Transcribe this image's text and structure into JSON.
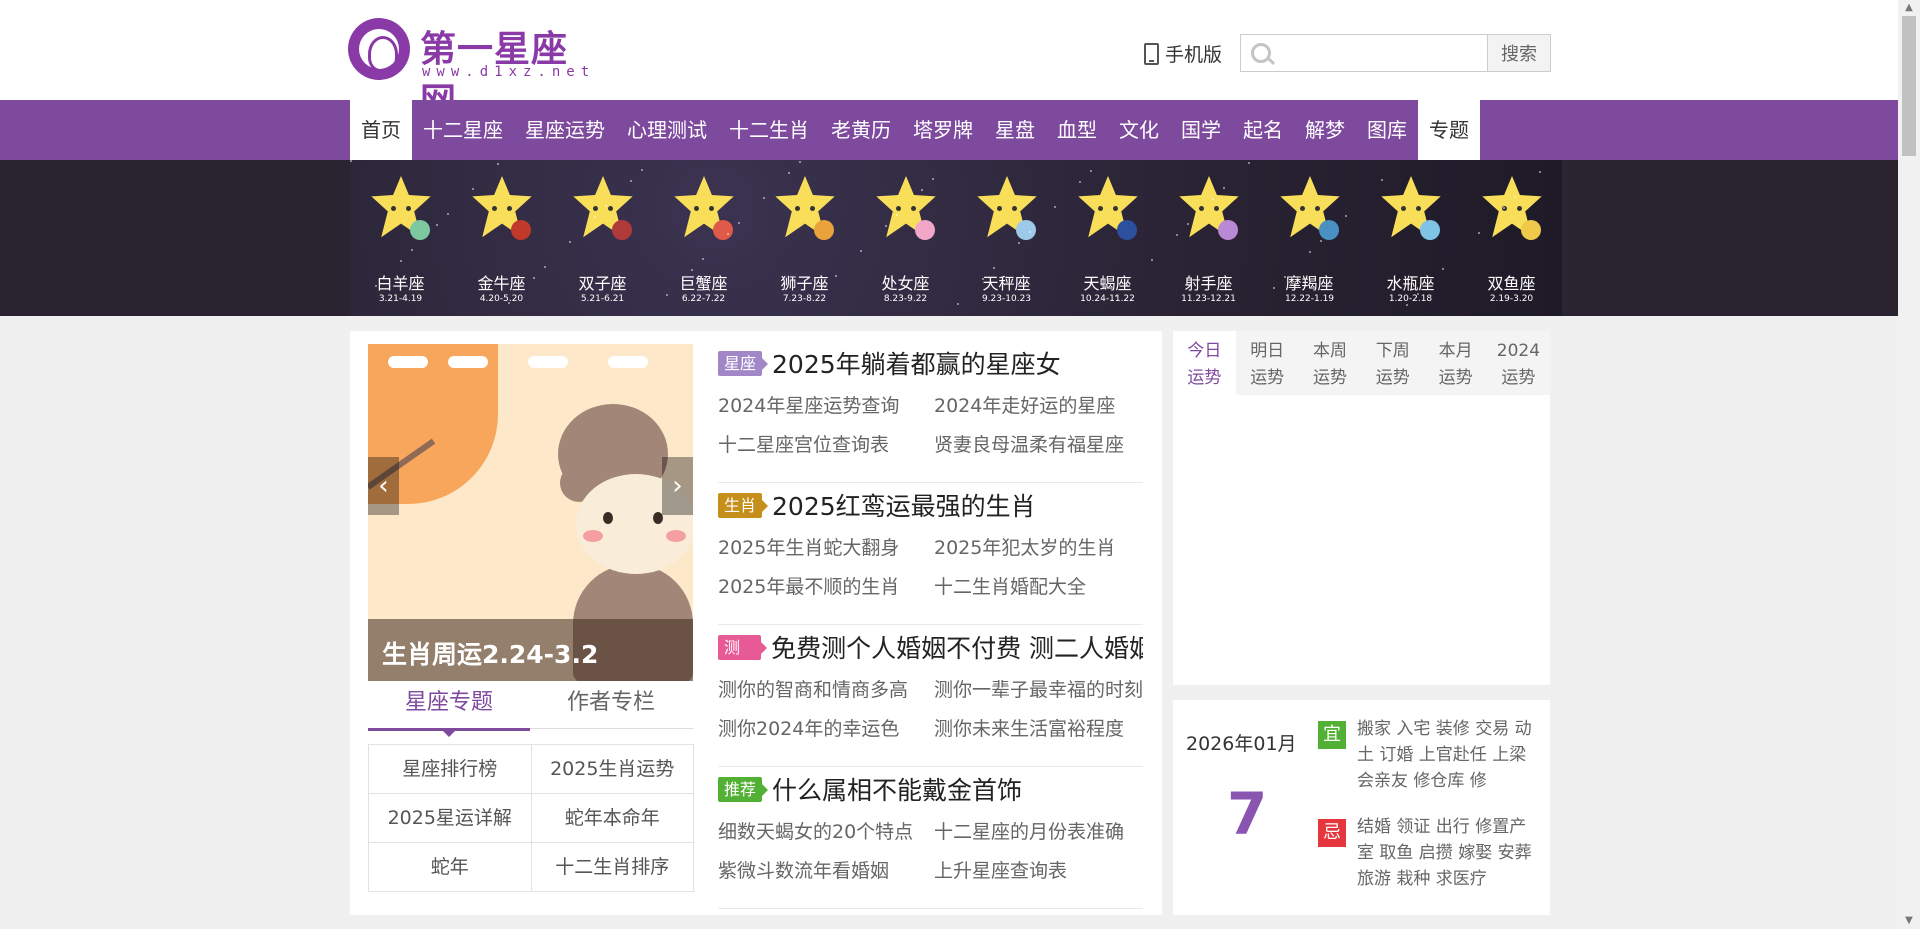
{
  "header": {
    "logo_title": "第一星座网",
    "logo_url": "www.d1xz.net",
    "mobile_label": "手机版",
    "search_placeholder": "",
    "search_button": "搜索"
  },
  "nav": {
    "items": [
      "首页",
      "十二星座",
      "星座运势",
      "心理测试",
      "十二生肖",
      "老黄历",
      "塔罗牌",
      "星盘",
      "血型",
      "文化",
      "国学",
      "起名",
      "解梦",
      "图库",
      "专题"
    ],
    "active_index": [
      0,
      14
    ]
  },
  "zodiacs": [
    {
      "name": "白羊座",
      "date": "3.21-4.19",
      "accent": "#7ec8a0"
    },
    {
      "name": "金牛座",
      "date": "4.20-5.20",
      "accent": "#c0392b"
    },
    {
      "name": "双子座",
      "date": "5.21-6.21",
      "accent": "#b03a3a"
    },
    {
      "name": "巨蟹座",
      "date": "6.22-7.22",
      "accent": "#e05a4a"
    },
    {
      "name": "狮子座",
      "date": "7.23-8.22",
      "accent": "#e8a33c"
    },
    {
      "name": "处女座",
      "date": "8.23-9.22",
      "accent": "#f2a7c9"
    },
    {
      "name": "天秤座",
      "date": "9.23-10.23",
      "accent": "#9ec9e8"
    },
    {
      "name": "天蝎座",
      "date": "10.24-11.22",
      "accent": "#2c4f9e"
    },
    {
      "name": "射手座",
      "date": "11.23-12.21",
      "accent": "#b989d6"
    },
    {
      "name": "摩羯座",
      "date": "12.22-1.19",
      "accent": "#4a90c2"
    },
    {
      "name": "水瓶座",
      "date": "1.20-2.18",
      "accent": "#7fc3e6"
    },
    {
      "name": "双鱼座",
      "date": "2.19-3.20",
      "accent": "#f0c94a"
    }
  ],
  "slider": {
    "caption": "生肖周运2.24-3.2",
    "prev_icon": "chevron-left-icon",
    "next_icon": "chevron-right-icon"
  },
  "tabs": [
    "星座专题",
    "作者专栏"
  ],
  "topics": [
    "星座排行榜",
    "2025生肖运势",
    "2025星运详解",
    "蛇年本命年",
    "蛇年",
    "十二生肖排序"
  ],
  "news": [
    {
      "tag": "星座",
      "tag_color": "#a187c8",
      "title": "2025年躺着都赢的星座女",
      "links": [
        "2024年星座运势查询",
        "2024年走好运的星座",
        "十二星座宫位查询表",
        "贤妻良母温柔有福星座"
      ]
    },
    {
      "tag": "生肖",
      "tag_color": "#c68e1a",
      "title": "2025红鸾运最强的生肖",
      "links": [
        "2025年生肖蛇大翻身",
        "2025年犯太岁的生肖",
        "2025年最不顺的生肖",
        "十二生肖婚配大全"
      ]
    },
    {
      "tag": "测试",
      "tag_color": "#e85a95",
      "title": "免费测个人婚姻不付费 测二人婚姻",
      "links": [
        "测你的智商和情商多高",
        "测你一辈子最幸福的时刻",
        "测你2024年的幸运色",
        "测你未来生活富裕程度"
      ]
    },
    {
      "tag": "推荐",
      "tag_color": "#52b134",
      "title": "什么属相不能戴金首饰",
      "links": [
        "细数天蝎女的20个特点",
        "十二星座的月份表准确",
        "紫微斗数流年看婚姻",
        "上升星座查询表"
      ]
    }
  ],
  "fortune_tabs": [
    {
      "line1": "今日",
      "line2": "运势"
    },
    {
      "line1": "明日",
      "line2": "运势"
    },
    {
      "line1": "本周",
      "line2": "运势"
    },
    {
      "line1": "下周",
      "line2": "运势"
    },
    {
      "line1": "本月",
      "line2": "运势"
    },
    {
      "line1": "2024",
      "line2": "运势"
    }
  ],
  "calendar": {
    "month": "2026年01月",
    "day": "7",
    "yi_label": "宜",
    "yi_text": "搬家 入宅 装修 交易 动土 订婚 上官赴任 上梁 会亲友 修仓库 修",
    "ji_label": "忌",
    "ji_text": "结婚 领证 出行 修置产室 取鱼 启攒 嫁娶 安葬 旅游 栽种 求医疗"
  },
  "colors": {
    "nav_bg": "#7d4a9e",
    "accent": "#8a55b1",
    "yi": "#52b134",
    "ji": "#e4363c"
  }
}
